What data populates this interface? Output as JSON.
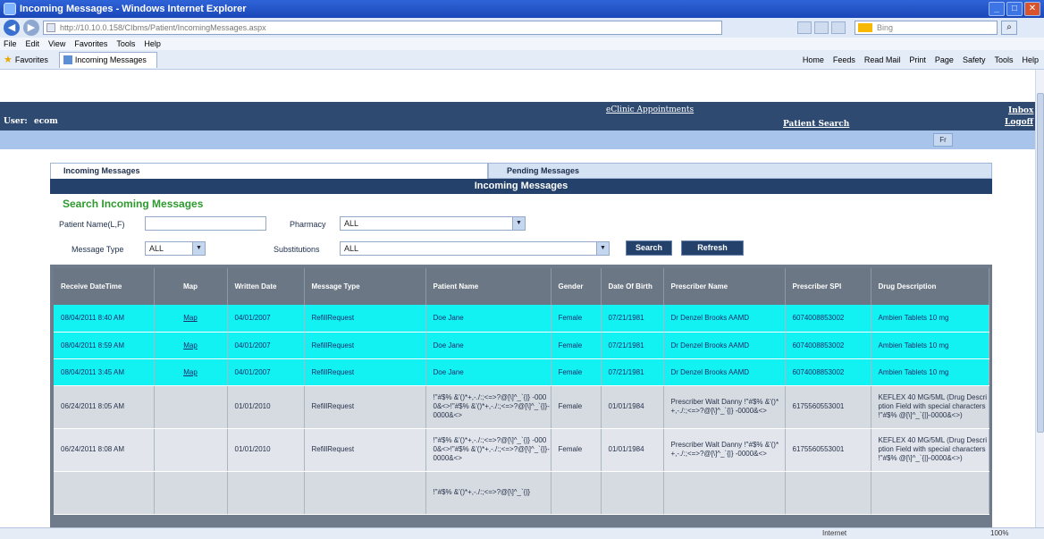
{
  "browser": {
    "title": "Incoming Messages - Windows Internet Explorer",
    "address": "http://10.10.0.158/CIbms/Patient/IncomingMessages.aspx",
    "search_placeholder": "Bing",
    "menu": [
      "File",
      "Edit",
      "View",
      "Favorites",
      "Tools",
      "Help"
    ],
    "favorites_label": "Favorites",
    "tab_label": "Incoming Messages",
    "commands": [
      "Home",
      "Feeds",
      "Read Mail",
      "Print",
      "Page",
      "Safety",
      "Tools",
      "Help"
    ],
    "status_zone": "Internet",
    "status_zoom": "100%"
  },
  "app": {
    "user_label": "User:",
    "user_value": "ecom",
    "eclinic_link": "eClinic Appointments",
    "patient_search": "Patient Search",
    "inbox": "Inbox",
    "logoff": "Logoff",
    "fr_button": "Fr"
  },
  "tabs": {
    "incoming": "Incoming Messages",
    "pending": "Pending Messages"
  },
  "panel_title": "Incoming Messages",
  "search": {
    "title": "Search Incoming Messages",
    "patient_name_label": "Patient Name(L,F)",
    "patient_name_value": "",
    "pharmacy_label": "Pharmacy",
    "pharmacy_value": "ALL",
    "message_type_label": "Message Type",
    "message_type_value": "ALL",
    "substitutions_label": "Substitutions",
    "substitutions_value": "ALL",
    "search_button": "Search",
    "refresh_button": "Refresh"
  },
  "grid": {
    "columns": [
      "Receive DateTime",
      "Map",
      "Written Date",
      "Message Type",
      "Patient Name",
      "Gender",
      "Date Of Birth",
      "Prescriber Name",
      "Prescriber SPI",
      "Drug Description"
    ],
    "rows": [
      {
        "receive": "08/04/2011 8:40 AM",
        "map": "Map",
        "written": "04/01/2007",
        "type": "RefillRequest",
        "patient": "Doe Jane",
        "gender": "Female",
        "dob": "07/21/1981",
        "prescriber": "Dr Denzel Brooks AAMD",
        "spi": "6074008853002",
        "drug": "Ambien Tablets 10 mg"
      },
      {
        "receive": "08/04/2011 8:59 AM",
        "map": "Map",
        "written": "04/01/2007",
        "type": "RefillRequest",
        "patient": "Doe Jane",
        "gender": "Female",
        "dob": "07/21/1981",
        "prescriber": "Dr Denzel Brooks AAMD",
        "spi": "6074008853002",
        "drug": "Ambien Tablets 10 mg"
      },
      {
        "receive": "08/04/2011 3:45 AM",
        "map": "Map",
        "written": "04/01/2007",
        "type": "RefillRequest",
        "patient": "Doe Jane",
        "gender": "Female",
        "dob": "07/21/1981",
        "prescriber": "Dr Denzel Brooks AAMD",
        "spi": "6074008853002",
        "drug": "Ambien Tablets 10 mg"
      },
      {
        "receive": "06/24/2011 8:05 AM",
        "map": "",
        "written": "01/01/2010",
        "type": "RefillRequest",
        "patient": "!\"#$% &'()*+,-./:;<=>?@[\\]^_`{|} -0000&<>!\"#$% &'()*+,-./:;<=>?@[\\]^_`{|}-0000&<>",
        "gender": "Female",
        "dob": "01/01/1984",
        "prescriber": "Prescriber Walt Danny !\"#$% &'()*+,-./:;<=>?@[\\]^_`{|} -0000&<>",
        "spi": "6175560553001",
        "drug": "KEFLEX 40 MG/5ML (Drug Description Field with special characters !\"#$% @[\\]^_`{|}-0000&<>)"
      },
      {
        "receive": "06/24/2011 8:08 AM",
        "map": "",
        "written": "01/01/2010",
        "type": "RefillRequest",
        "patient": "!\"#$% &'()*+,-./:;<=>?@[\\]^_`{|} -0000&<>!\"#$% &'()*+,-./:;<=>?@[\\]^_`{|}-0000&<>",
        "gender": "Female",
        "dob": "01/01/1984",
        "prescriber": "Prescriber Walt Danny !\"#$% &'()*+,-./:;<=>?@[\\]^_`{|} -0000&<>",
        "spi": "6175560553001",
        "drug": "KEFLEX 40 MG/5ML (Drug Description Field with special characters !\"#$% @[\\]^_`{|}-0000&<>)"
      },
      {
        "receive": "",
        "map": "",
        "written": "",
        "type": "",
        "patient": "!\"#$% &'()*+,-./:;<=>?@[\\]^_`{|}",
        "gender": "",
        "dob": "",
        "prescriber": "",
        "spi": "",
        "drug": ""
      }
    ]
  },
  "colors": {
    "highlight_row": "#12f2f2",
    "header_dark": "#23416a",
    "search_title": "#2f9a2f"
  }
}
